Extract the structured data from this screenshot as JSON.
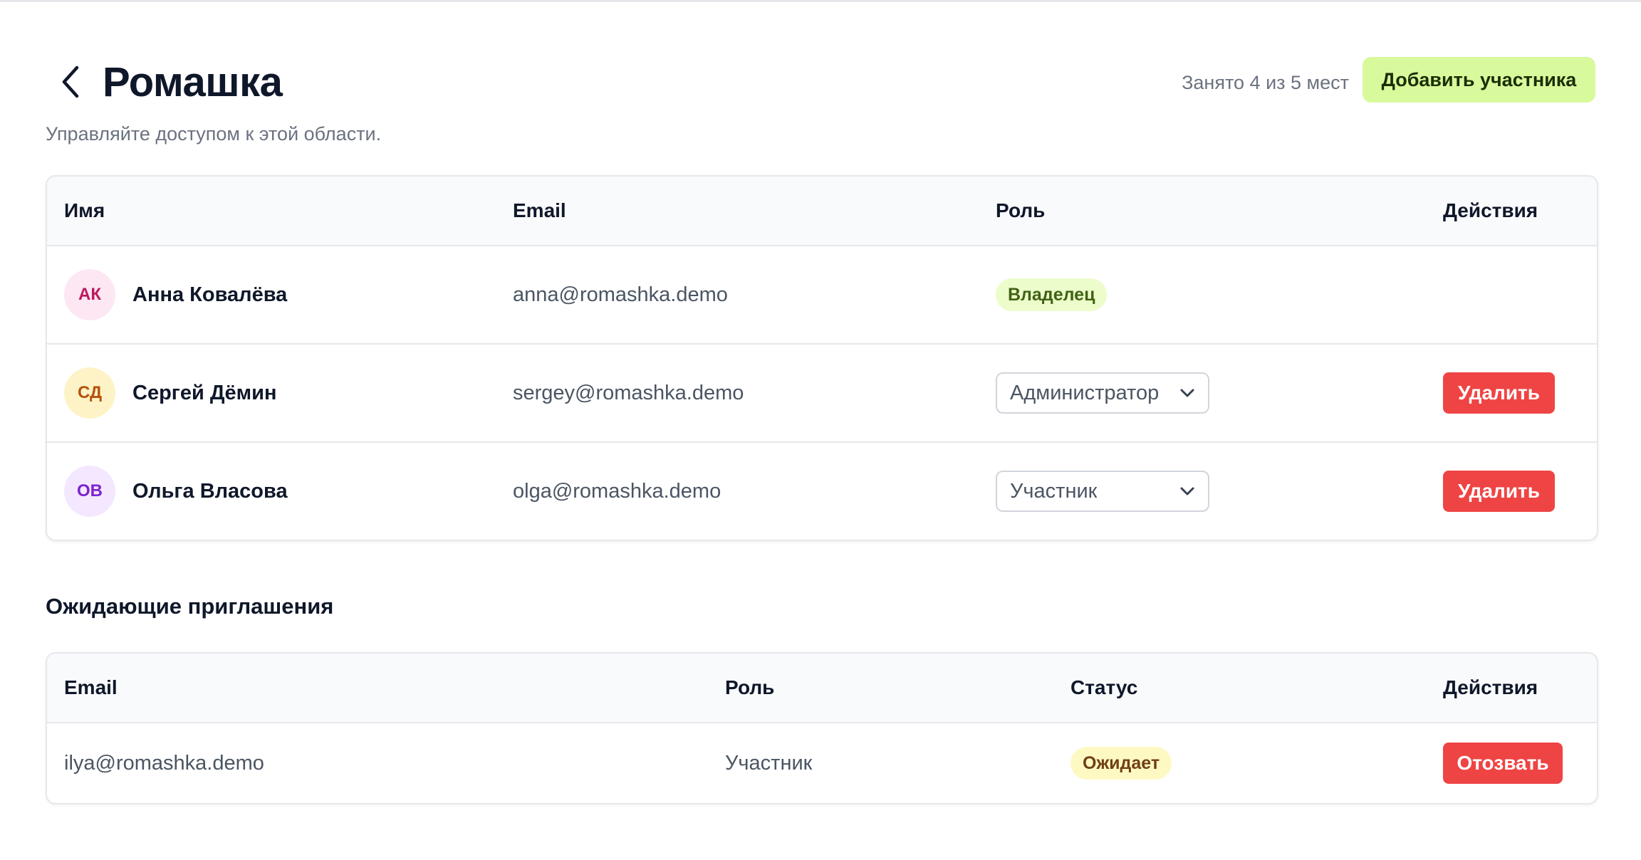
{
  "header": {
    "title": "Ромашка",
    "subtitle": "Управляйте доступом к этой области.",
    "seats_text": "Занято 4 из 5 мест",
    "add_button": "Добавить участника"
  },
  "members_table": {
    "columns": [
      "Имя",
      "Email",
      "Роль",
      "Действия"
    ],
    "rows": [
      {
        "initials": "АК",
        "name": "Анна Ковалёва",
        "email": "anna@romashka.demo",
        "role": "Владелец",
        "role_type": "badge",
        "action": "",
        "avatar_bg": "#fce7f3",
        "avatar_fg": "#be185d"
      },
      {
        "initials": "СД",
        "name": "Сергей Дёмин",
        "email": "sergey@romashka.demo",
        "role": "Администратор",
        "role_type": "select",
        "action": "Удалить",
        "avatar_bg": "#fef3c7",
        "avatar_fg": "#b45309"
      },
      {
        "initials": "ОВ",
        "name": "Ольга Власова",
        "email": "olga@romashka.demo",
        "role": "Участник",
        "role_type": "select",
        "action": "Удалить",
        "avatar_bg": "#f3e8ff",
        "avatar_fg": "#7e22ce"
      }
    ]
  },
  "invites": {
    "section_title": "Ожидающие приглашения",
    "columns": [
      "Email",
      "Роль",
      "Статус",
      "Действия"
    ],
    "rows": [
      {
        "email": "ilya@romashka.demo",
        "role": "Участник",
        "status": "Ожидает",
        "action": "Отозвать"
      }
    ]
  },
  "colors": {
    "accent": "#d9f99d",
    "danger": "#ef4444",
    "owner_badge": "#ecfccb",
    "pending_badge": "#fef9c3"
  }
}
